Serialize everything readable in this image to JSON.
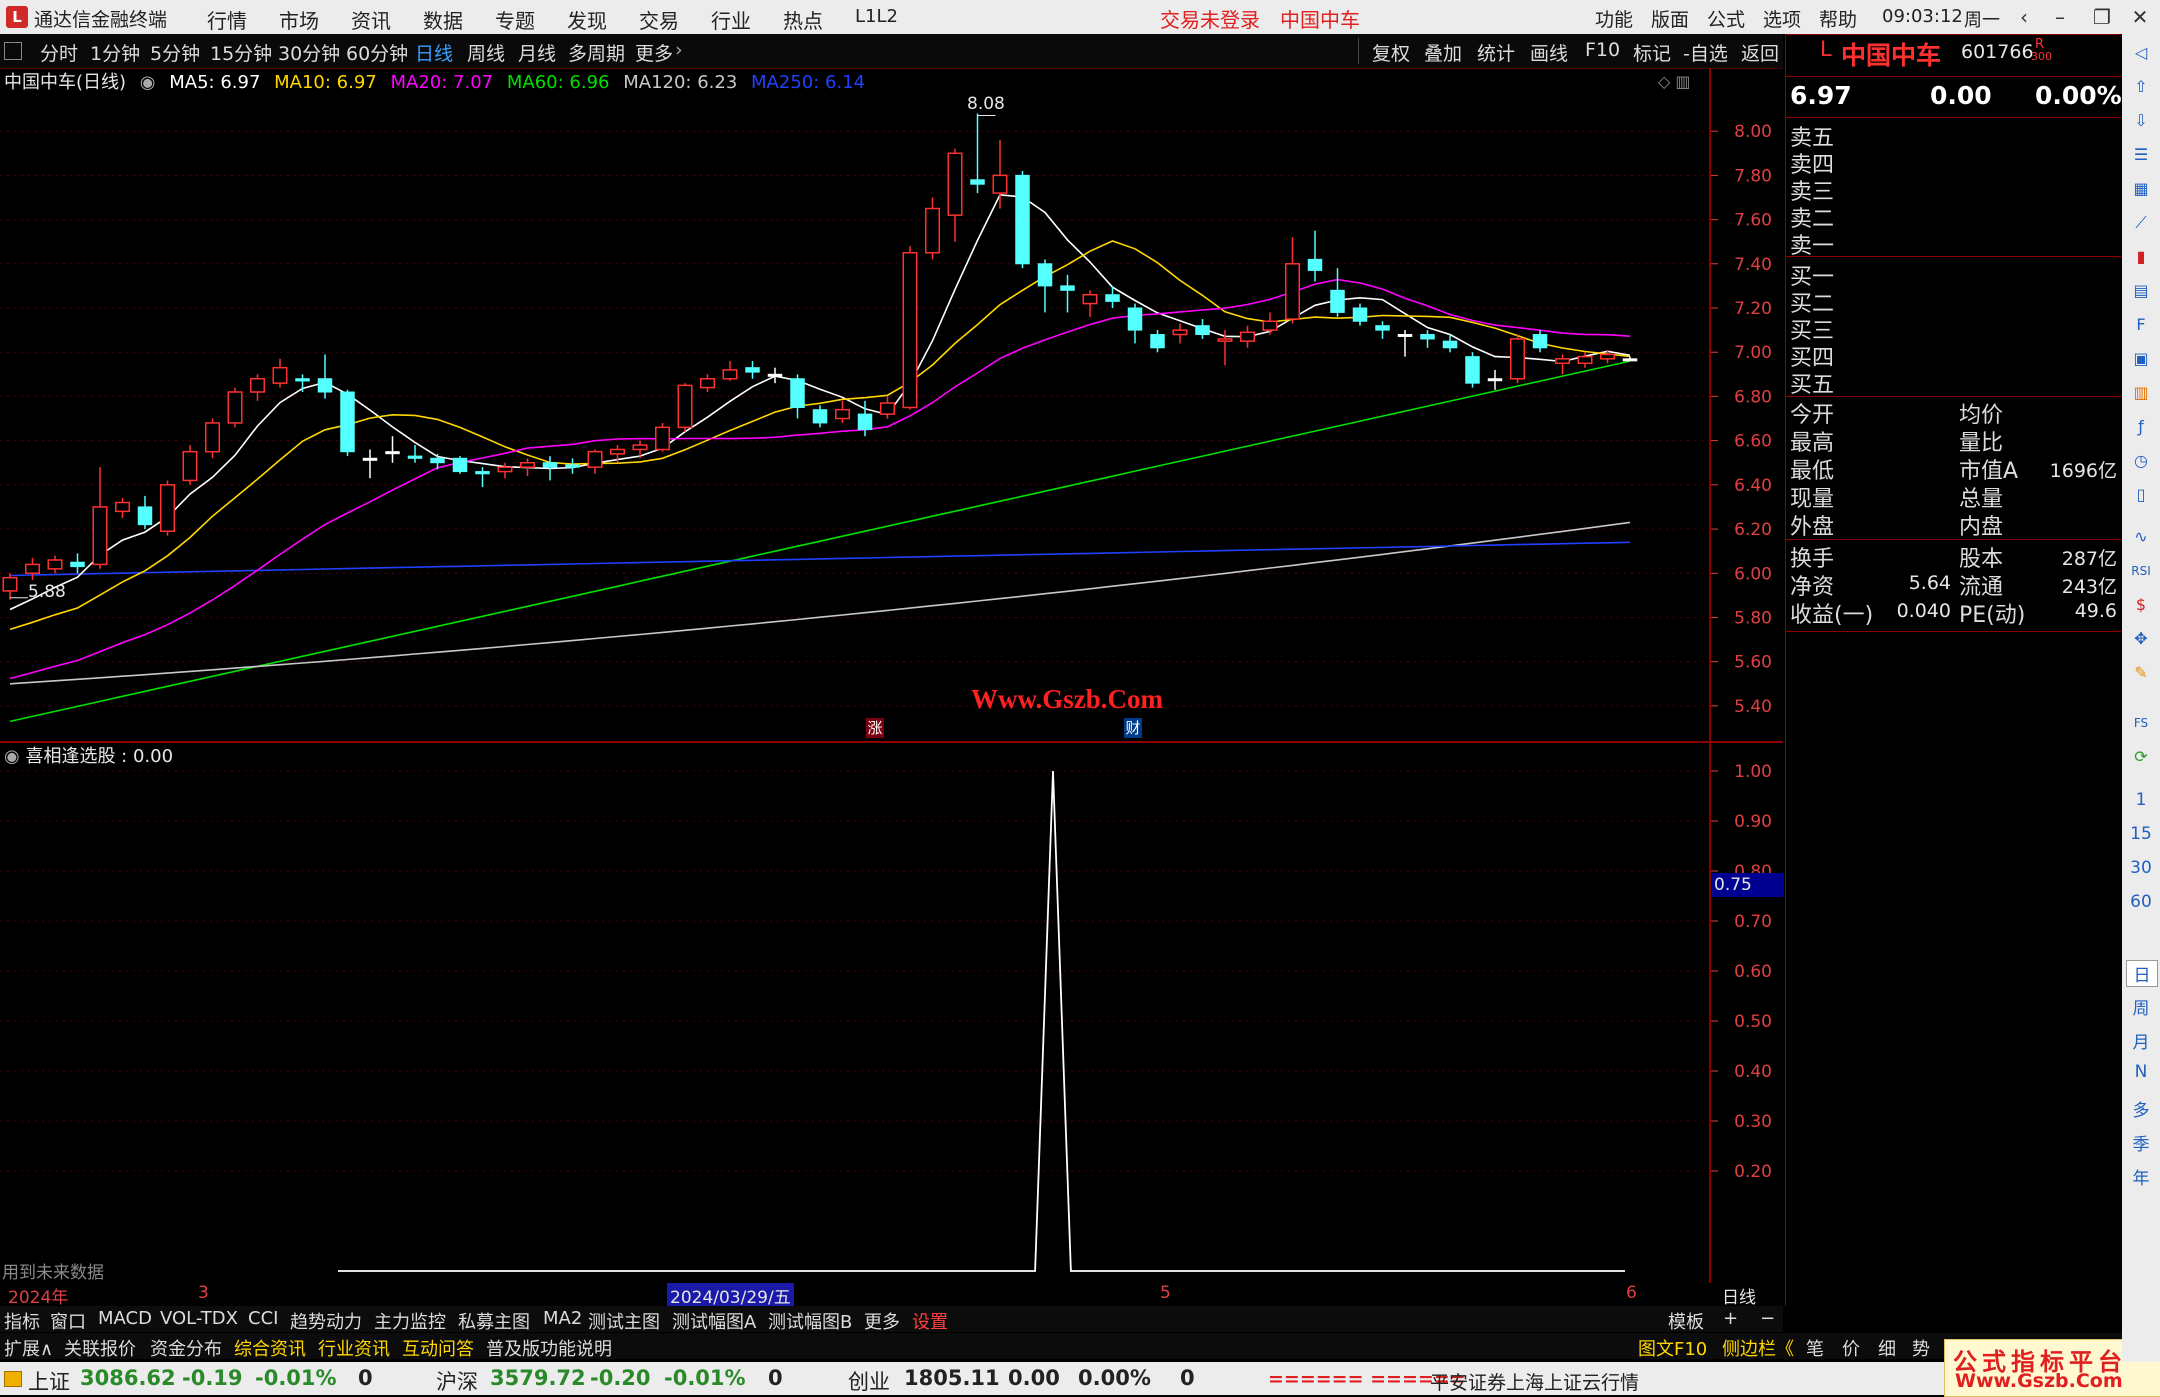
{
  "app": {
    "title": "通达信金融终端",
    "menu": [
      "行情",
      "市场",
      "资讯",
      "数据",
      "专题",
      "发现",
      "交易",
      "行业",
      "热点",
      "L1L2"
    ],
    "login_status": "交易未登录",
    "stock_title": "中国中车",
    "right_menu": [
      "功能",
      "版面",
      "公式",
      "选项",
      "帮助"
    ],
    "clock": "09:03:12",
    "weekday": "周一"
  },
  "period_toolbar": {
    "items": [
      "分时",
      "1分钟",
      "5分钟",
      "15分钟",
      "30分钟",
      "60分钟",
      "日线",
      "周线",
      "月线",
      "多周期",
      "更多"
    ],
    "active": "日线",
    "right_items": [
      "复权",
      "叠加",
      "统计",
      "画线",
      "F10",
      "标记",
      "-自选",
      "返回"
    ]
  },
  "legend": {
    "name": "中国中车(日线)",
    "items": [
      {
        "label": "MA5: 6.97",
        "color": "#ffffff"
      },
      {
        "label": "MA10: 6.97",
        "color": "#ffd700"
      },
      {
        "label": "MA20: 7.07",
        "color": "#ff00ff"
      },
      {
        "label": "MA60: 6.96",
        "color": "#00e000"
      },
      {
        "label": "MA120: 6.23",
        "color": "#c8c8c8"
      },
      {
        "label": "MA250: 6.14",
        "color": "#2040ff"
      }
    ]
  },
  "watermark": "Www.Gszb.Com",
  "event_markers": [
    "涨",
    "财"
  ],
  "price_labels": {
    "high": "8.08",
    "low": "5.88"
  },
  "indicator": {
    "label": "喜相逢选股 : 0.00",
    "current_value_tag": "0.75",
    "future_data_note": "用到未来数据"
  },
  "date_axis": {
    "labels": [
      "2024年",
      "3",
      "5",
      "6"
    ],
    "cursor_date": "2024/03/29/五",
    "period_label": "日线"
  },
  "indicator_tabs": [
    "指标",
    "窗口",
    "MACD",
    "VOL-TDX",
    "CCI",
    "趋势动力",
    "主力监控",
    "私募主图",
    "MA2",
    "测试主图",
    "测试幅图A",
    "测试幅图B",
    "更多",
    "设置"
  ],
  "indicator_tabs_right": [
    "模板",
    "+",
    "−"
  ],
  "bottom_tabs": [
    "扩展∧",
    "关联报价",
    "资金分布",
    "综合资讯",
    "行业资讯",
    "互动问答",
    "普及版功能说明"
  ],
  "bottom_tabs_right": [
    "图文F10",
    "侧边栏《",
    "笔",
    "价",
    "细",
    "势"
  ],
  "status_bar": {
    "indices": [
      {
        "name": "上证",
        "value": "3086.62",
        "change": "-0.19",
        "pct": "-0.01%",
        "vol": "0"
      },
      {
        "name": "沪深",
        "value": "3579.72",
        "change": "-0.20",
        "pct": "-0.01%",
        "vol": "0"
      },
      {
        "name": "创业",
        "value": "1805.11",
        "change": "0.00",
        "pct": "0.00%",
        "vol": "0"
      }
    ],
    "broker_bar": "====== ======",
    "broker": "平安证券上海上证云行情",
    "site_watermark_top": "公式指标平台",
    "site_watermark_bottom": "Www.Gszb.Com"
  },
  "quote_panel": {
    "code_prefix": "L",
    "name": "中国中车",
    "code": "601766",
    "badge": "R",
    "badge_sub": "300",
    "price": "6.97",
    "change": "0.00",
    "pct": "0.00%",
    "sell_levels": [
      "卖五",
      "卖四",
      "卖三",
      "卖二",
      "卖一"
    ],
    "buy_levels": [
      "买一",
      "买二",
      "买三",
      "买四",
      "买五"
    ],
    "stats_left": [
      "今开",
      "最高",
      "最低",
      "现量",
      "外盘"
    ],
    "stats_right": [
      {
        "label": "均价",
        "value": ""
      },
      {
        "label": "量比",
        "value": ""
      },
      {
        "label": "市值A",
        "value": "1696亿"
      },
      {
        "label": "总量",
        "value": ""
      },
      {
        "label": "内盘",
        "value": ""
      }
    ],
    "fin": [
      {
        "label": "换手",
        "value": "",
        "label2": "股本",
        "value2": "287亿"
      },
      {
        "label": "净资",
        "value": "5.64",
        "label2": "流通",
        "value2": "243亿"
      },
      {
        "label": "收益(一)",
        "value": "0.040",
        "label2": "PE(动)",
        "value2": "49.6"
      }
    ]
  },
  "vertical_toolbar": [
    "1",
    "15",
    "30",
    "60",
    "日",
    "周",
    "月",
    "N",
    "多",
    "季",
    "年"
  ],
  "colors": {
    "up": "#ff3030",
    "down": "#54ffff",
    "ma5": "#ffffff",
    "ma10": "#ffd700",
    "ma20": "#ff00ff",
    "ma60": "#00e000",
    "ma120": "#c8c8c8",
    "ma250": "#2040ff",
    "axis": "#e04040"
  },
  "chart_data": [
    {
      "type": "candlestick",
      "title": "中国中车(日线)",
      "y_ticks": [
        "8.00",
        "7.80",
        "7.60",
        "7.40",
        "7.20",
        "7.00",
        "6.80",
        "6.60",
        "6.40",
        "6.20",
        "6.00",
        "5.80",
        "5.60",
        "5.40"
      ],
      "ylim": [
        5.3,
        8.15
      ],
      "candles": [
        {
          "o": 5.92,
          "c": 5.98,
          "h": 6.0,
          "l": 5.88
        },
        {
          "o": 6.0,
          "c": 6.04,
          "h": 6.07,
          "l": 5.97
        },
        {
          "o": 6.02,
          "c": 6.06,
          "h": 6.08,
          "l": 6.0
        },
        {
          "o": 6.05,
          "c": 6.03,
          "h": 6.09,
          "l": 6.0
        },
        {
          "o": 6.04,
          "c": 6.3,
          "h": 6.48,
          "l": 6.02
        },
        {
          "o": 6.28,
          "c": 6.32,
          "h": 6.34,
          "l": 6.25
        },
        {
          "o": 6.3,
          "c": 6.22,
          "h": 6.35,
          "l": 6.2
        },
        {
          "o": 6.19,
          "c": 6.4,
          "h": 6.42,
          "l": 6.17
        },
        {
          "o": 6.42,
          "c": 6.55,
          "h": 6.58,
          "l": 6.4
        },
        {
          "o": 6.55,
          "c": 6.68,
          "h": 6.7,
          "l": 6.52
        },
        {
          "o": 6.68,
          "c": 6.82,
          "h": 6.84,
          "l": 6.66
        },
        {
          "o": 6.82,
          "c": 6.88,
          "h": 6.9,
          "l": 6.78
        },
        {
          "o": 6.86,
          "c": 6.93,
          "h": 6.97,
          "l": 6.84
        },
        {
          "o": 6.88,
          "c": 6.87,
          "h": 6.9,
          "l": 6.82
        },
        {
          "o": 6.88,
          "c": 6.82,
          "h": 6.99,
          "l": 6.79
        },
        {
          "o": 6.82,
          "c": 6.55,
          "h": 6.83,
          "l": 6.53
        },
        {
          "o": 6.52,
          "c": 6.52,
          "h": 6.56,
          "l": 6.43
        },
        {
          "o": 6.55,
          "c": 6.55,
          "h": 6.62,
          "l": 6.5
        },
        {
          "o": 6.53,
          "c": 6.52,
          "h": 6.58,
          "l": 6.5
        },
        {
          "o": 6.52,
          "c": 6.5,
          "h": 6.54,
          "l": 6.47
        },
        {
          "o": 6.52,
          "c": 6.46,
          "h": 6.53,
          "l": 6.45
        },
        {
          "o": 6.46,
          "c": 6.45,
          "h": 6.48,
          "l": 6.39
        },
        {
          "o": 6.46,
          "c": 6.48,
          "h": 6.5,
          "l": 6.43
        },
        {
          "o": 6.48,
          "c": 6.5,
          "h": 6.52,
          "l": 6.44
        },
        {
          "o": 6.5,
          "c": 6.48,
          "h": 6.53,
          "l": 6.42
        },
        {
          "o": 6.49,
          "c": 6.48,
          "h": 6.52,
          "l": 6.45
        },
        {
          "o": 6.48,
          "c": 6.55,
          "h": 6.56,
          "l": 6.45
        },
        {
          "o": 6.54,
          "c": 6.56,
          "h": 6.58,
          "l": 6.5
        },
        {
          "o": 6.56,
          "c": 6.58,
          "h": 6.6,
          "l": 6.52
        },
        {
          "o": 6.56,
          "c": 6.66,
          "h": 6.68,
          "l": 6.55
        },
        {
          "o": 6.66,
          "c": 6.85,
          "h": 6.86,
          "l": 6.64
        },
        {
          "o": 6.84,
          "c": 6.88,
          "h": 6.9,
          "l": 6.82
        },
        {
          "o": 6.88,
          "c": 6.92,
          "h": 6.96,
          "l": 6.87
        },
        {
          "o": 6.93,
          "c": 6.91,
          "h": 6.96,
          "l": 6.88
        },
        {
          "o": 6.9,
          "c": 6.9,
          "h": 6.93,
          "l": 6.86
        },
        {
          "o": 6.88,
          "c": 6.75,
          "h": 6.9,
          "l": 6.7
        },
        {
          "o": 6.74,
          "c": 6.68,
          "h": 6.76,
          "l": 6.66
        },
        {
          "o": 6.7,
          "c": 6.74,
          "h": 6.78,
          "l": 6.68
        },
        {
          "o": 6.72,
          "c": 6.65,
          "h": 6.78,
          "l": 6.62
        },
        {
          "o": 6.72,
          "c": 6.77,
          "h": 6.8,
          "l": 6.7
        },
        {
          "o": 6.75,
          "c": 7.45,
          "h": 7.48,
          "l": 6.74
        },
        {
          "o": 7.45,
          "c": 7.65,
          "h": 7.7,
          "l": 7.42
        },
        {
          "o": 7.62,
          "c": 7.9,
          "h": 7.92,
          "l": 7.5
        },
        {
          "o": 7.78,
          "c": 7.76,
          "h": 8.08,
          "l": 7.72
        },
        {
          "o": 7.72,
          "c": 7.8,
          "h": 7.96,
          "l": 7.65
        },
        {
          "o": 7.8,
          "c": 7.4,
          "h": 7.82,
          "l": 7.38
        },
        {
          "o": 7.4,
          "c": 7.3,
          "h": 7.42,
          "l": 7.18
        },
        {
          "o": 7.3,
          "c": 7.28,
          "h": 7.35,
          "l": 7.18
        },
        {
          "o": 7.22,
          "c": 7.26,
          "h": 7.28,
          "l": 7.16
        },
        {
          "o": 7.26,
          "c": 7.23,
          "h": 7.3,
          "l": 7.2
        },
        {
          "o": 7.2,
          "c": 7.1,
          "h": 7.22,
          "l": 7.04
        },
        {
          "o": 7.08,
          "c": 7.02,
          "h": 7.1,
          "l": 7.0
        },
        {
          "o": 7.08,
          "c": 7.1,
          "h": 7.13,
          "l": 7.04
        },
        {
          "o": 7.12,
          "c": 7.08,
          "h": 7.15,
          "l": 7.06
        },
        {
          "o": 7.05,
          "c": 7.06,
          "h": 7.1,
          "l": 6.94
        },
        {
          "o": 7.05,
          "c": 7.09,
          "h": 7.12,
          "l": 7.02
        },
        {
          "o": 7.1,
          "c": 7.14,
          "h": 7.18,
          "l": 7.08
        },
        {
          "o": 7.15,
          "c": 7.4,
          "h": 7.52,
          "l": 7.13
        },
        {
          "o": 7.42,
          "c": 7.37,
          "h": 7.55,
          "l": 7.32
        },
        {
          "o": 7.28,
          "c": 7.18,
          "h": 7.38,
          "l": 7.16
        },
        {
          "o": 7.2,
          "c": 7.14,
          "h": 7.22,
          "l": 7.12
        },
        {
          "o": 7.12,
          "c": 7.1,
          "h": 7.14,
          "l": 7.06
        },
        {
          "o": 7.08,
          "c": 7.08,
          "h": 7.1,
          "l": 6.98
        },
        {
          "o": 7.08,
          "c": 7.06,
          "h": 7.1,
          "l": 7.02
        },
        {
          "o": 7.05,
          "c": 7.02,
          "h": 7.08,
          "l": 7.0
        },
        {
          "o": 6.98,
          "c": 6.86,
          "h": 7.0,
          "l": 6.84
        },
        {
          "o": 6.88,
          "c": 6.88,
          "h": 6.92,
          "l": 6.83
        },
        {
          "o": 6.88,
          "c": 7.06,
          "h": 7.08,
          "l": 6.86
        },
        {
          "o": 7.08,
          "c": 7.02,
          "h": 7.1,
          "l": 7.0
        },
        {
          "o": 6.95,
          "c": 6.97,
          "h": 6.99,
          "l": 6.9
        },
        {
          "o": 6.95,
          "c": 6.98,
          "h": 7.0,
          "l": 6.93
        },
        {
          "o": 6.97,
          "c": 6.99,
          "h": 7.01,
          "l": 6.95
        },
        {
          "o": 6.97,
          "c": 6.97,
          "h": 6.98,
          "l": 6.96
        }
      ],
      "ma_series": [
        {
          "name": "MA5",
          "values_first_last": [
            5.85,
            6.97
          ]
        },
        {
          "name": "MA10",
          "values_first_last": [
            5.78,
            6.97
          ]
        },
        {
          "name": "MA20",
          "values_first_last": [
            5.56,
            7.07
          ]
        },
        {
          "name": "MA60",
          "values_first_last": [
            5.33,
            6.96
          ]
        },
        {
          "name": "MA120",
          "values_first_last": [
            5.5,
            6.23
          ]
        },
        {
          "name": "MA250",
          "values_first_last": [
            5.99,
            6.14
          ]
        }
      ]
    },
    {
      "type": "line",
      "title": "喜相逢选股",
      "y_ticks": [
        "1.00",
        "0.90",
        "0.80",
        "0.70",
        "0.60",
        "0.50",
        "0.40",
        "0.30",
        "0.20"
      ],
      "ylim": [
        0.0,
        1.0
      ],
      "values": [
        0,
        0,
        0,
        0,
        0,
        0,
        0,
        0,
        0,
        0,
        0,
        0,
        0,
        0,
        0,
        0,
        0,
        0,
        0,
        0,
        0,
        0,
        0,
        0,
        0,
        0,
        0,
        0,
        0,
        0,
        0,
        0,
        0,
        0,
        0,
        0,
        0,
        0,
        0,
        0,
        1,
        0,
        0,
        0,
        0,
        0,
        0,
        0,
        0,
        0,
        0,
        0,
        0,
        0,
        0,
        0,
        0,
        0,
        0,
        0,
        0,
        0,
        0,
        0,
        0,
        0,
        0,
        0,
        0,
        0,
        0,
        0,
        0
      ]
    }
  ]
}
